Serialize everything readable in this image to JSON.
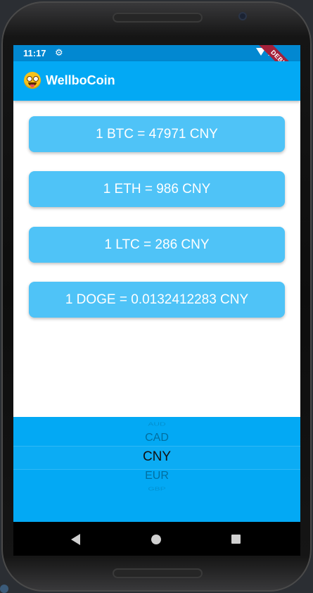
{
  "status_bar": {
    "time": "11:17"
  },
  "debug_banner": "DEBUG",
  "app_bar": {
    "title": "WellboCoin"
  },
  "rates": [
    {
      "label": "1 BTC = 47971 CNY"
    },
    {
      "label": "1 ETH = 986 CNY"
    },
    {
      "label": "1 LTC = 286 CNY"
    },
    {
      "label": "1 DOGE = 0.0132412283 CNY"
    }
  ],
  "currency_picker": {
    "items": [
      "AUD",
      "CAD",
      "CNY",
      "EUR",
      "GBP"
    ],
    "selected": "CNY"
  },
  "colors": {
    "primary": "#03a9f4",
    "status_bar": "#0288d1",
    "card": "#4fc3f7",
    "debug": "#a5213a"
  }
}
